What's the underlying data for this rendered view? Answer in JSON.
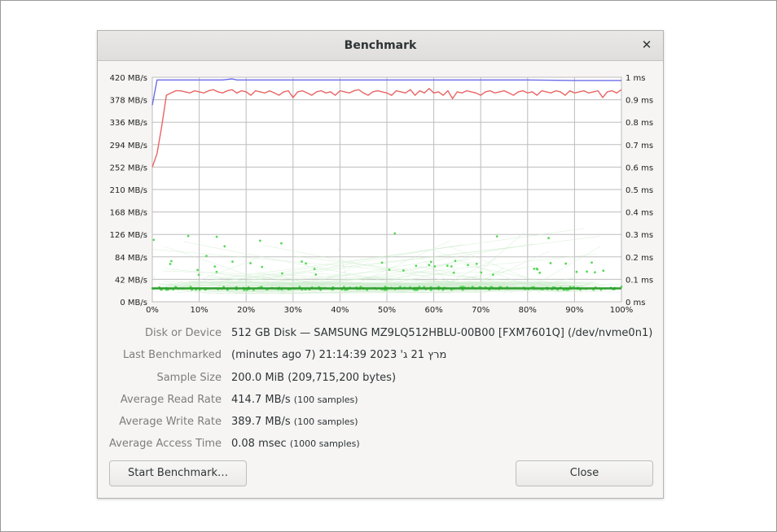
{
  "dialog": {
    "title": "Benchmark",
    "close_icon": "close-icon",
    "start_button": "Start Benchmark…",
    "close_button": "Close"
  },
  "chart_data": {
    "type": "line",
    "x_range": [
      0,
      100
    ],
    "x_ticks": [
      "0%",
      "10%",
      "20%",
      "30%",
      "40%",
      "50%",
      "60%",
      "70%",
      "80%",
      "90%",
      "100%"
    ],
    "y_left_range": [
      0,
      420
    ],
    "y_left_ticks": [
      "0 MB/s",
      "42 MB/s",
      "84 MB/s",
      "126 MB/s",
      "168 MB/s",
      "210 MB/s",
      "252 MB/s",
      "294 MB/s",
      "336 MB/s",
      "378 MB/s",
      "420 MB/s"
    ],
    "y_right_range": [
      0,
      1
    ],
    "y_right_ticks": [
      "0 ms",
      "0.1 ms",
      "0.2 ms",
      "0.3 ms",
      "0.4 ms",
      "0.5 ms",
      "0.6 ms",
      "0.7 ms",
      "0.8 ms",
      "0.9 ms",
      "1 ms"
    ],
    "grid": true,
    "series": [
      {
        "color": "#6b6bea",
        "axis": "left",
        "x": [
          0,
          1,
          5,
          10,
          15,
          17,
          18,
          20,
          30,
          40,
          50,
          60,
          70,
          80,
          90,
          100
        ],
        "y": [
          368,
          415,
          415,
          415,
          415,
          417,
          415,
          415,
          415,
          415,
          415,
          415,
          415,
          415,
          414,
          414
        ]
      },
      {
        "color": "#ea6464",
        "axis": "right",
        "x": [
          0,
          1,
          2,
          3,
          4,
          5,
          6,
          7,
          8,
          9,
          10,
          11,
          12,
          13,
          14,
          15,
          16,
          17,
          18,
          19,
          20,
          21,
          22,
          23,
          24,
          25,
          26,
          27,
          28,
          29,
          30,
          31,
          32,
          33,
          34,
          35,
          36,
          37,
          38,
          39,
          40,
          41,
          42,
          43,
          44,
          45,
          46,
          47,
          48,
          49,
          50,
          51,
          52,
          53,
          54,
          55,
          56,
          57,
          58,
          59,
          60,
          61,
          62,
          63,
          64,
          65,
          66,
          67,
          68,
          69,
          70,
          71,
          72,
          73,
          74,
          75,
          76,
          77,
          78,
          79,
          80,
          81,
          82,
          83,
          84,
          85,
          86,
          87,
          88,
          89,
          90,
          91,
          92,
          93,
          94,
          95,
          96,
          97,
          98,
          99,
          100
        ],
        "y": [
          0.6,
          0.66,
          0.78,
          0.92,
          0.93,
          0.94,
          0.94,
          0.935,
          0.93,
          0.94,
          0.935,
          0.93,
          0.94,
          0.945,
          0.935,
          0.93,
          0.94,
          0.945,
          0.93,
          0.94,
          0.935,
          0.92,
          0.94,
          0.935,
          0.93,
          0.94,
          0.93,
          0.92,
          0.935,
          0.94,
          0.91,
          0.935,
          0.94,
          0.93,
          0.92,
          0.935,
          0.94,
          0.93,
          0.935,
          0.92,
          0.94,
          0.935,
          0.93,
          0.94,
          0.945,
          0.93,
          0.92,
          0.935,
          0.94,
          0.935,
          0.93,
          0.92,
          0.94,
          0.935,
          0.93,
          0.945,
          0.92,
          0.94,
          0.93,
          0.95,
          0.93,
          0.935,
          0.92,
          0.94,
          0.905,
          0.935,
          0.93,
          0.94,
          0.935,
          0.93,
          0.92,
          0.935,
          0.94,
          0.93,
          0.935,
          0.94,
          0.93,
          0.92,
          0.935,
          0.94,
          0.93,
          0.935,
          0.92,
          0.94,
          0.935,
          0.93,
          0.94,
          0.935,
          0.92,
          0.94,
          0.93,
          0.935,
          0.94,
          0.93,
          0.935,
          0.94,
          0.91,
          0.935,
          0.94,
          0.93,
          0.945
        ]
      },
      {
        "color": "#58d958",
        "axis": "right",
        "style": "access-time scatter",
        "typical": 0.06,
        "max": 0.31
      }
    ]
  },
  "info": {
    "rows": [
      {
        "label": "Disk or Device",
        "value": "512 GB Disk — SAMSUNG MZ9LQ512HBLU-00B00 [FXM7601Q] (/dev/nvme0n1)",
        "note": ""
      },
      {
        "label": "Last Benchmarked",
        "value": "(minutes ago 7) מרץ 21 ג' 2023 21:14:39",
        "note": ""
      },
      {
        "label": "Sample Size",
        "value": "200.0 MiB (209,715,200 bytes)",
        "note": ""
      },
      {
        "label": "Average Read Rate",
        "value": "414.7 MB/s",
        "note": "(100 samples)"
      },
      {
        "label": "Average Write Rate",
        "value": "389.7 MB/s",
        "note": "(100 samples)"
      },
      {
        "label": "Average Access Time",
        "value": "0.08 msec",
        "note": "(1000 samples)"
      }
    ]
  }
}
